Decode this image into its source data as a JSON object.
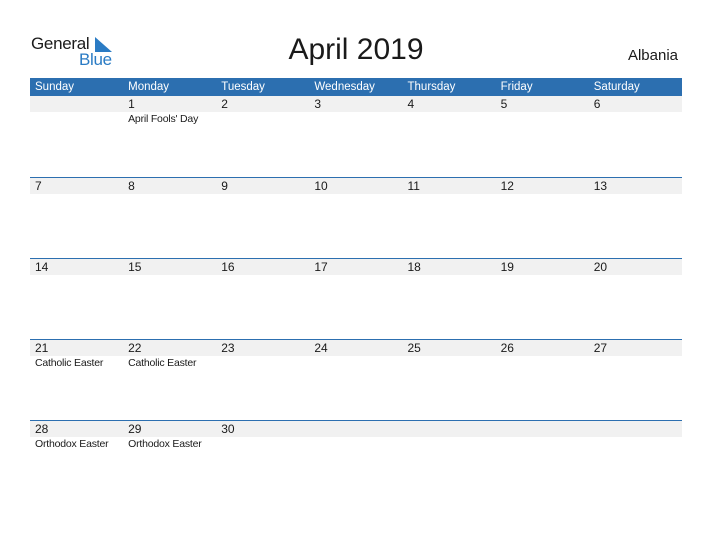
{
  "logo": {
    "word1": "General",
    "word2": "Blue"
  },
  "title": "April 2019",
  "country": "Albania",
  "colors": {
    "header_bg": "#2c6fb0",
    "logo_blue": "#2a7bc4",
    "band": "#f1f1f1"
  },
  "weekdays": [
    "Sunday",
    "Monday",
    "Tuesday",
    "Wednesday",
    "Thursday",
    "Friday",
    "Saturday"
  ],
  "weeks": [
    [
      {
        "day": "",
        "event": ""
      },
      {
        "day": "1",
        "event": "April Fools' Day"
      },
      {
        "day": "2",
        "event": ""
      },
      {
        "day": "3",
        "event": ""
      },
      {
        "day": "4",
        "event": ""
      },
      {
        "day": "5",
        "event": ""
      },
      {
        "day": "6",
        "event": ""
      }
    ],
    [
      {
        "day": "7",
        "event": ""
      },
      {
        "day": "8",
        "event": ""
      },
      {
        "day": "9",
        "event": ""
      },
      {
        "day": "10",
        "event": ""
      },
      {
        "day": "11",
        "event": ""
      },
      {
        "day": "12",
        "event": ""
      },
      {
        "day": "13",
        "event": ""
      }
    ],
    [
      {
        "day": "14",
        "event": ""
      },
      {
        "day": "15",
        "event": ""
      },
      {
        "day": "16",
        "event": ""
      },
      {
        "day": "17",
        "event": ""
      },
      {
        "day": "18",
        "event": ""
      },
      {
        "day": "19",
        "event": ""
      },
      {
        "day": "20",
        "event": ""
      }
    ],
    [
      {
        "day": "21",
        "event": "Catholic Easter"
      },
      {
        "day": "22",
        "event": "Catholic Easter"
      },
      {
        "day": "23",
        "event": ""
      },
      {
        "day": "24",
        "event": ""
      },
      {
        "day": "25",
        "event": ""
      },
      {
        "day": "26",
        "event": ""
      },
      {
        "day": "27",
        "event": ""
      }
    ],
    [
      {
        "day": "28",
        "event": "Orthodox Easter"
      },
      {
        "day": "29",
        "event": "Orthodox Easter"
      },
      {
        "day": "30",
        "event": ""
      },
      {
        "day": "",
        "event": ""
      },
      {
        "day": "",
        "event": ""
      },
      {
        "day": "",
        "event": ""
      },
      {
        "day": "",
        "event": ""
      }
    ]
  ]
}
